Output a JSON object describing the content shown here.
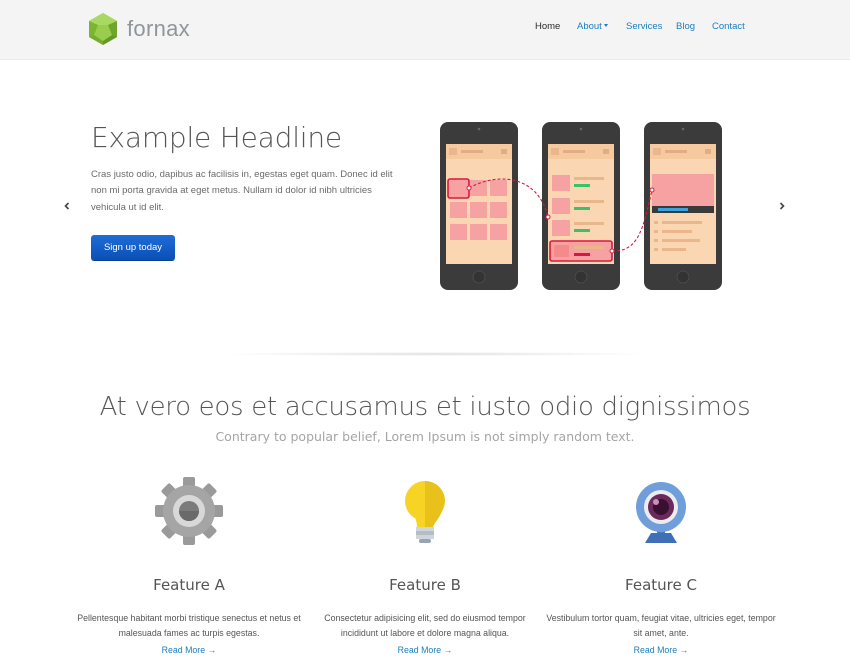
{
  "header": {
    "logo_text": "fornax",
    "nav": [
      {
        "label": "Home",
        "active": true
      },
      {
        "label": "About",
        "dropdown": true
      },
      {
        "label": "Services"
      },
      {
        "label": "Blog"
      },
      {
        "label": "Contact"
      }
    ]
  },
  "hero": {
    "title": "Example Headline",
    "text": "Cras justo odio, dapibus ac facilisis in, egestas eget quam. Donec id elit non mi porta gravida at eget metus. Nullam id dolor id nibh ultricies vehicula ut id elit.",
    "button_label": "Sign up today",
    "prev_icon": "chevron-left-icon",
    "next_icon": "chevron-right-icon"
  },
  "section": {
    "title": "At vero eos et accusamus et iusto odio dignissimos",
    "subtitle": "Contrary to popular belief, Lorem Ipsum is not simply random text."
  },
  "features": [
    {
      "icon": "gear-icon",
      "title": "Feature A",
      "text": "Pellentesque habitant morbi tristique senectus et netus et malesuada fames ac turpis egestas.",
      "link": "Read More →"
    },
    {
      "icon": "lightbulb-icon",
      "title": "Feature B",
      "text": "Consectetur adipisicing elit, sed do eiusmod tempor incididunt ut labore et dolore magna aliqua.",
      "link": "Read More →"
    },
    {
      "icon": "webcam-icon",
      "title": "Feature C",
      "text": "Vestibulum tortor quam, feugiat vitae, ultricies eget, tempor sit amet, ante.",
      "link": "Read More →"
    }
  ],
  "colors": {
    "link": "#1a7fc1",
    "button": "#0d55bd",
    "header_bg": "#f4f4f4",
    "logo_green": "#8cc63f",
    "phone_screen": "#fbd6b2",
    "phone_accent": "#f7a2a2"
  }
}
